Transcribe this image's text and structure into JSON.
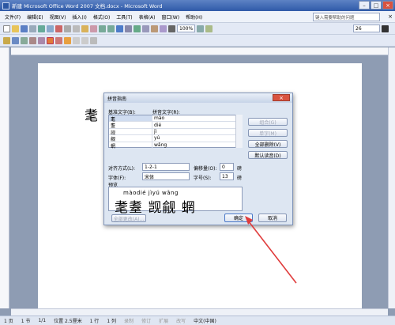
{
  "window": {
    "title": "新建 Microsoft Office Word 2007 文档.docx - Microsoft Word"
  },
  "menu": {
    "items": [
      "文件(F)",
      "编辑(E)",
      "视图(V)",
      "插入(I)",
      "格式(O)",
      "工具(T)",
      "表格(A)",
      "窗口(W)",
      "帮助(H)"
    ],
    "help_placeholder": "键入需要帮助的问题"
  },
  "toolbar": {
    "zoom": "100%",
    "font_size": "26"
  },
  "document": {
    "visible_text": "耄"
  },
  "dialog": {
    "title": "拼音指南",
    "base_label": "基准文字(B):",
    "ruby_label": "拼音文字(R):",
    "rows": [
      {
        "base": "耄",
        "ruby": "mào"
      },
      {
        "base": "耋",
        "ruby": "dié"
      },
      {
        "base": "觊",
        "ruby": "jì"
      },
      {
        "base": "觎",
        "ruby": "yú"
      },
      {
        "base": "蝄",
        "ruby": "wǎng"
      }
    ],
    "btn_combine": "组合(G)",
    "btn_single": "单字(M)",
    "btn_clear_all": "全部删除(V)",
    "btn_default": "默认读音(D)",
    "align_label": "对齐方式(L):",
    "align_value": "1-2-1",
    "offset_label": "偏移量(O):",
    "offset_value": "0",
    "offset_unit": "磅",
    "font_label": "字体(F):",
    "font_value": "宋体",
    "size_label": "字号(S):",
    "size_value": "13",
    "size_unit": "磅",
    "preview_label": "预览",
    "preview_pinyin": "màodié  jìyú  wǎng",
    "preview_chars": "耄耋 觊觎 蝄",
    "btn_change_all": "全部更改(A)...",
    "btn_ok": "确定",
    "btn_cancel": "取消"
  },
  "statusbar": {
    "page": "1 页",
    "section": "1 节",
    "pages": "1/1",
    "position": "位置 2.5厘米",
    "line": "1 行",
    "column": "1 列",
    "rec": "录制",
    "trk": "修订",
    "ext": "扩展",
    "ovr": "改写",
    "language": "中文(中国)"
  },
  "colors": {
    "annotation_arrow": "#e03c3c",
    "title_bar": "#2f5aa8"
  },
  "icons": [
    "word-icon",
    "close-icon",
    "minimize-icon",
    "maximize-icon"
  ]
}
